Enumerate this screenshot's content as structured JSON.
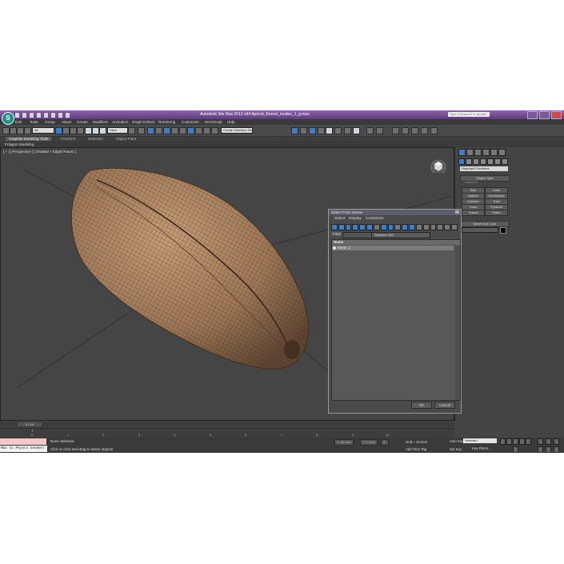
{
  "app": {
    "title": "Autodesk 3ds Max  2012 x64     Apricot_Kernel_modes_1_g.max",
    "search_placeholder": "Type a keyword or phrase",
    "logo": "S"
  },
  "menu": [
    "Edit",
    "Tools",
    "Group",
    "Views",
    "Create",
    "Modifiers",
    "Animation",
    "Graph Editors",
    "Rendering",
    "Customize",
    "MAXScript",
    "Help"
  ],
  "toolbar": {
    "selection_filter": "All",
    "ref_coord": "View",
    "named_selection": "Create Selection Se"
  },
  "ribbon": {
    "tabs": [
      "Graphite Modeling Tools",
      "Freeform",
      "Selection",
      "Object Paint"
    ],
    "sub": "Polygon Modeling"
  },
  "viewport": {
    "label": "[ + ] [ Perspective ] [ Shaded + Edged Faces ]"
  },
  "command_panel": {
    "category": "Standard Primitives",
    "object_type_title": "Object Type",
    "autogrid": "AutoGrid",
    "primitives": [
      "Box",
      "Cone",
      "Sphere",
      "GeoSphere",
      "Cylinder",
      "Tube",
      "Torus",
      "Pyramid",
      "Teapot",
      "Plane"
    ],
    "name_color_title": "Name and Color"
  },
  "dialog": {
    "title": "Select From Scene",
    "menu": [
      "Select",
      "Display",
      "Customize"
    ],
    "find_label": "Find:",
    "selection_set": "Selection Set:",
    "column_name": "Name",
    "items": [
      "Seme_1"
    ],
    "ok": "OK",
    "cancel": "Cancel"
  },
  "timeline": {
    "frame": "0 / 10",
    "ticks": [
      "0",
      "1",
      "2",
      "3",
      "4",
      "5",
      "6",
      "7",
      "8",
      "9",
      "10"
    ]
  },
  "status": {
    "selection": "None Selected",
    "prompt": "Click or click-and-drag to select objects",
    "maxscript": "Max to Physcs Geometr",
    "x": "X: 80.35m",
    "y": "Y: 1.00m",
    "z": "Z:",
    "grid": "Grid = 10.0cm",
    "add_time_tag": "Add Time Tag",
    "auto_key": "Auto Key",
    "set_key": "Set Key",
    "key_mode": "Selected",
    "key_filters": "Key Filters..."
  }
}
